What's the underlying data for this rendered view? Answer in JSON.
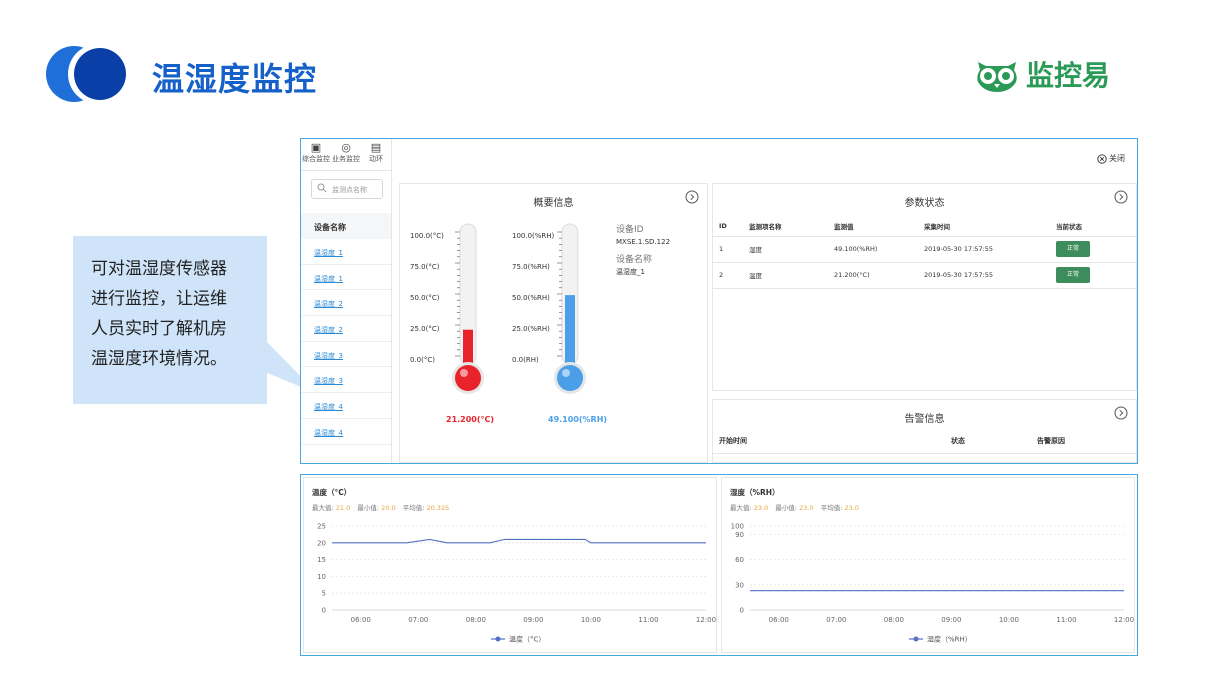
{
  "header": {
    "title": "温湿度监控",
    "brand": "监控易",
    "brand_color": "#2b9a57",
    "title_color": "#1560c9"
  },
  "callout": {
    "lines": [
      "可对温湿度传感器",
      "进行监控，让运维",
      "人员实时了解机房",
      "温湿度环境情况。"
    ]
  },
  "sidebar": {
    "tabs": [
      {
        "label": "综合监控",
        "icon": "monitor-icon"
      },
      {
        "label": "业务监控",
        "icon": "gauge-icon"
      },
      {
        "label": "动环",
        "icon": "ring-icon"
      }
    ],
    "search_placeholder": "监测点名称",
    "column_header": "设备名称",
    "devices": [
      "温湿度_1",
      "温湿度_1",
      "温湿度_2",
      "温湿度_2",
      "温湿度_3",
      "温湿度_3",
      "温湿度_4",
      "温湿度_4"
    ]
  },
  "toolbar": {
    "close_label": "关闭"
  },
  "overview": {
    "title": "概要信息",
    "temp_scale": [
      "100.0(°C)",
      "75.0(°C)",
      "50.0(°C)",
      "25.0(°C)",
      "0.0(°C)"
    ],
    "hum_scale": [
      "100.0(%RH)",
      "75.0(%RH)",
      "50.0(%RH)",
      "25.0(%RH)",
      "0.0(RH)"
    ],
    "temp_value": "21.200(°C)",
    "hum_value": "49.100(%RH)",
    "temp_level": 0.212,
    "hum_level": 0.491,
    "device_id_label": "设备ID",
    "device_id": "MXSE.1.SD.122",
    "device_name_label": "设备名称",
    "device_name": "温湿度_1",
    "temp_color": "#e8232a",
    "hum_color": "#4a9fe8"
  },
  "params": {
    "title": "参数状态",
    "columns": [
      "ID",
      "监测项名称",
      "监测值",
      "采集时间",
      "当前状态"
    ],
    "rows": [
      {
        "id": "1",
        "name": "湿度",
        "value": "49.100(%RH)",
        "time": "2019-05-30 17:57:55",
        "status": "正常"
      },
      {
        "id": "2",
        "name": "温度",
        "value": "21.200(°C)",
        "time": "2019-05-30 17:57:55",
        "status": "正常"
      }
    ],
    "status_color": "#3c8c5c"
  },
  "alarms": {
    "title": "告警信息",
    "columns": [
      "开始时间",
      "状态",
      "告警原因"
    ]
  },
  "chart_data": [
    {
      "type": "line",
      "title": "温度（°C）",
      "stats": {
        "max_label": "最大值:",
        "max": "21.0",
        "min_label": "最小值:",
        "min": "20.0",
        "avg_label": "平均值:",
        "avg": "20.325"
      },
      "x_ticks": [
        "06:00",
        "07:00",
        "08:00",
        "09:00",
        "10:00",
        "11:00",
        "12:00"
      ],
      "y_ticks": [
        0,
        5,
        10,
        15,
        20,
        25
      ],
      "ylim": [
        0,
        25
      ],
      "xlim": [
        5.5,
        12.0
      ],
      "series": [
        {
          "name": "温度（°C）",
          "x": [
            5.5,
            6.25,
            6.8,
            7.2,
            7.5,
            8.25,
            8.5,
            9.3,
            9.9,
            10.0,
            12.0
          ],
          "y": [
            20,
            20,
            20,
            21,
            20,
            20,
            21,
            21,
            21,
            20,
            20
          ]
        }
      ],
      "grid": true,
      "legend": "bottom",
      "line_color": "#5470c6"
    },
    {
      "type": "line",
      "title": "湿度（%RH）",
      "stats": {
        "max_label": "最大值:",
        "max": "23.0",
        "min_label": "最小值:",
        "min": "23.0",
        "avg_label": "平均值:",
        "avg": "23.0"
      },
      "x_ticks": [
        "06:00",
        "07:00",
        "08:00",
        "09:00",
        "10:00",
        "11:00",
        "12:00"
      ],
      "y_ticks": [
        0,
        30,
        60,
        90,
        100
      ],
      "ylim": [
        0,
        100
      ],
      "xlim": [
        5.5,
        12.0
      ],
      "series": [
        {
          "name": "湿度（%RH）",
          "x": [
            5.5,
            12.0
          ],
          "y": [
            23,
            23
          ]
        }
      ],
      "grid": true,
      "legend": "bottom",
      "line_color": "#5470c6"
    }
  ]
}
